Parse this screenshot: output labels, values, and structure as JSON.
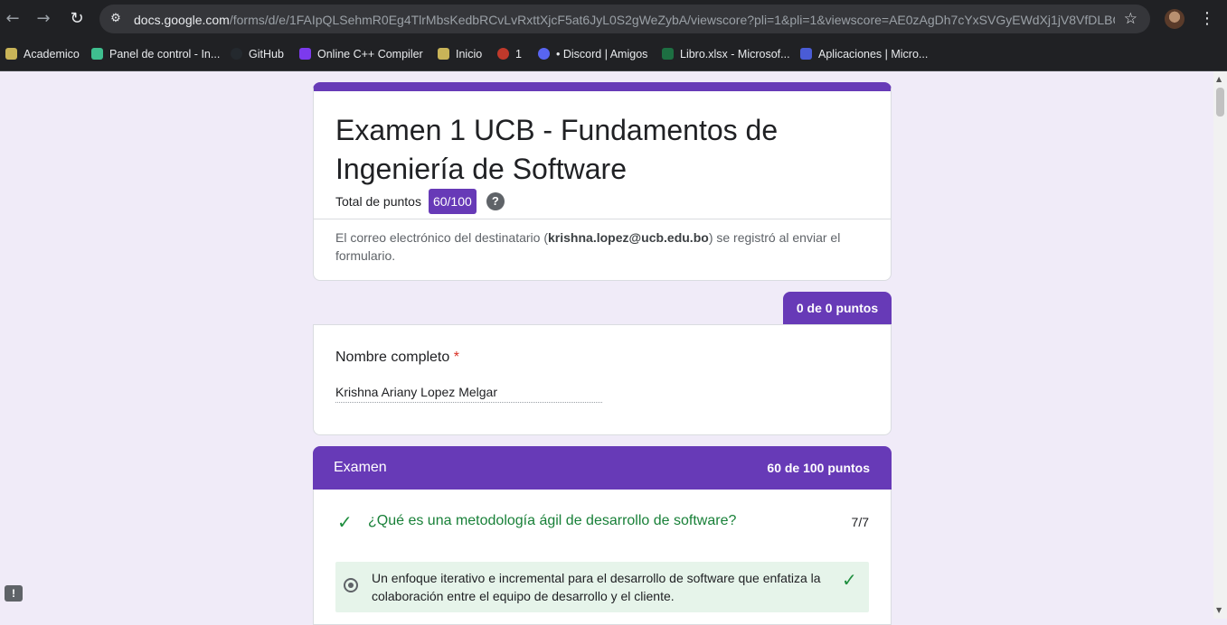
{
  "browser": {
    "url_host": "docs.google.com",
    "url_path": "/forms/d/e/1FAIpQLSehmR0Eg4TlrMbsKedbRCvLvRxttXjcF5at6JyL0S2gWeZybA/viewscore?pli=1&pli=1&viewscore=AE0zAgDh7cYxSVGyEWdXj1jV8VfDLBQKT..."
  },
  "bookmarks": [
    {
      "label": "Academico",
      "color": "#c9b458"
    },
    {
      "label": "Panel de control - In...",
      "color": "#3fbf8f"
    },
    {
      "label": "GitHub",
      "color": "#24292e"
    },
    {
      "label": "Online C++ Compiler",
      "color": "#7c3aed"
    },
    {
      "label": "Inicio",
      "color": "#c9b458"
    },
    {
      "label": "1",
      "color": "#c0392b"
    },
    {
      "label": "• Discord | Amigos",
      "color": "#5865f2"
    },
    {
      "label": "Libro.xlsx - Microsof...",
      "color": "#1d6f42"
    },
    {
      "label": "Aplicaciones | Micro...",
      "color": "#4a5cd6"
    }
  ],
  "form": {
    "title": "Examen 1 UCB - Fundamentos de Ingeniería de Software",
    "total_label": "Total de puntos",
    "total_score": "60/100",
    "email_prefix": "El correo electrónico del destinatario (",
    "email": "krishna.lopez@ucb.edu.bo",
    "email_suffix": ") se registró al enviar el formulario."
  },
  "section1": {
    "points": "0 de 0 puntos",
    "question": "Nombre completo",
    "required_mark": "*",
    "answer": "Krishna Ariany Lopez Melgar"
  },
  "exam": {
    "title": "Examen",
    "points": "60 de 100 puntos",
    "q1": {
      "text": "¿Qué es una metodología ágil de desarrollo de software?",
      "score": "7/7",
      "selected_answer": "Un enfoque iterativo e incremental para el desarrollo de software que enfatiza la colaboración entre el equipo de desarrollo y el cliente."
    }
  },
  "colors": {
    "accent": "#673ab7",
    "correct": "#188038",
    "correct_bg": "#e6f4ea"
  }
}
